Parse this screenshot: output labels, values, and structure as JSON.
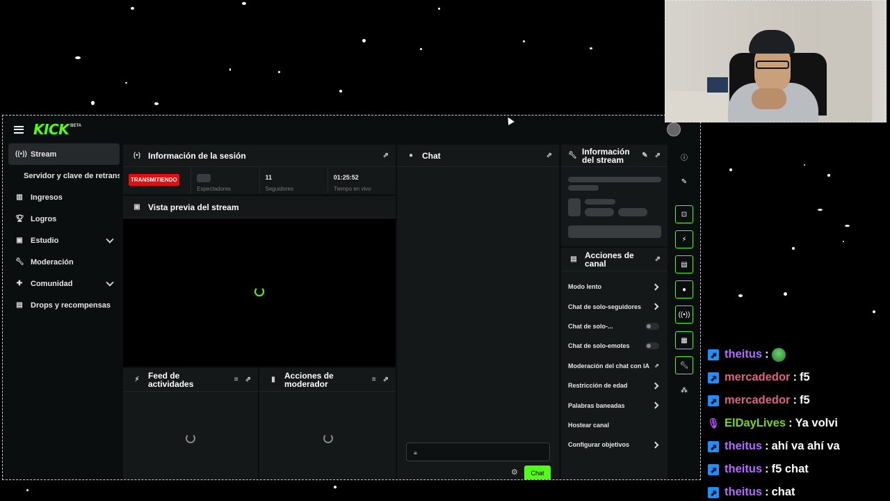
{
  "header": {
    "logo": "KICK",
    "logo_badge": "BETA"
  },
  "sidebar": {
    "items": [
      {
        "label": "Stream",
        "icon": "stream-icon",
        "active": true
      },
      {
        "label": "Servidor y clave de retransmisión",
        "sub": true
      },
      {
        "label": "Ingresos",
        "icon": "chart-icon"
      },
      {
        "label": "Logros",
        "icon": "trophy-icon"
      },
      {
        "label": "Estudio",
        "icon": "studio-icon",
        "expandable": true
      },
      {
        "label": "Moderación",
        "icon": "wrench-icon"
      },
      {
        "label": "Comunidad",
        "icon": "community-icon",
        "expandable": true
      },
      {
        "label": "Drops y recompensas",
        "icon": "gift-icon"
      }
    ]
  },
  "session": {
    "title": "Información de la sesión",
    "live_badge": "TRANSMITIENDO",
    "viewers_label": "Espectadores",
    "followers_value": "11",
    "followers_label": "Seguidores",
    "uptime_value": "01:25:52",
    "uptime_label": "Tiempo en vivo"
  },
  "preview": {
    "title": "Vista previa del stream"
  },
  "feed": {
    "title": "Feed de actividades"
  },
  "mod_actions": {
    "title": "Acciones de moderador"
  },
  "chat": {
    "title": "Chat",
    "send_label": "Chat"
  },
  "stream_info": {
    "title": "Información del stream"
  },
  "channel_actions": {
    "title": "Acciones de canal",
    "items": [
      {
        "label": "Modo lento",
        "control": "arrow"
      },
      {
        "label": "Chat de solo-seguidores",
        "control": "arrow"
      },
      {
        "label": "Chat de solo-...",
        "control": "toggle"
      },
      {
        "label": "Chat de solo-emotes",
        "control": "toggle"
      },
      {
        "label": "Moderación del chat con IA",
        "control": "external"
      },
      {
        "label": "Restricción de edad",
        "control": "arrow"
      },
      {
        "label": "Palabras baneadas",
        "control": "arrow"
      },
      {
        "label": "Hostear canal",
        "control": "none"
      },
      {
        "label": "Configurar objetivos",
        "control": "arrow"
      }
    ]
  },
  "overlay_chat": {
    "messages": [
      {
        "user": "theitus",
        "color": "#b26bff",
        "badge": "kick",
        "text": "",
        "emote": true
      },
      {
        "user": "mercadedor",
        "color": "#e0607e",
        "badge": "kick",
        "text": "f5"
      },
      {
        "user": "mercadedor",
        "color": "#e0607e",
        "badge": "kick",
        "text": "f5"
      },
      {
        "user": "ElDayLives",
        "color": "#7ed321",
        "badge": "mic",
        "text": "Ya volvi"
      },
      {
        "user": "theitus",
        "color": "#b26bff",
        "badge": "kick",
        "text": "ahí va ahí va"
      },
      {
        "user": "theitus",
        "color": "#b26bff",
        "badge": "kick",
        "text": "f5 chat"
      },
      {
        "user": "theitus",
        "color": "#b26bff",
        "badge": "kick",
        "text": "chat"
      }
    ]
  },
  "colors": {
    "brand_green": "#53fc18",
    "live_red": "#e10f0f",
    "panel_bg": "#151819"
  }
}
